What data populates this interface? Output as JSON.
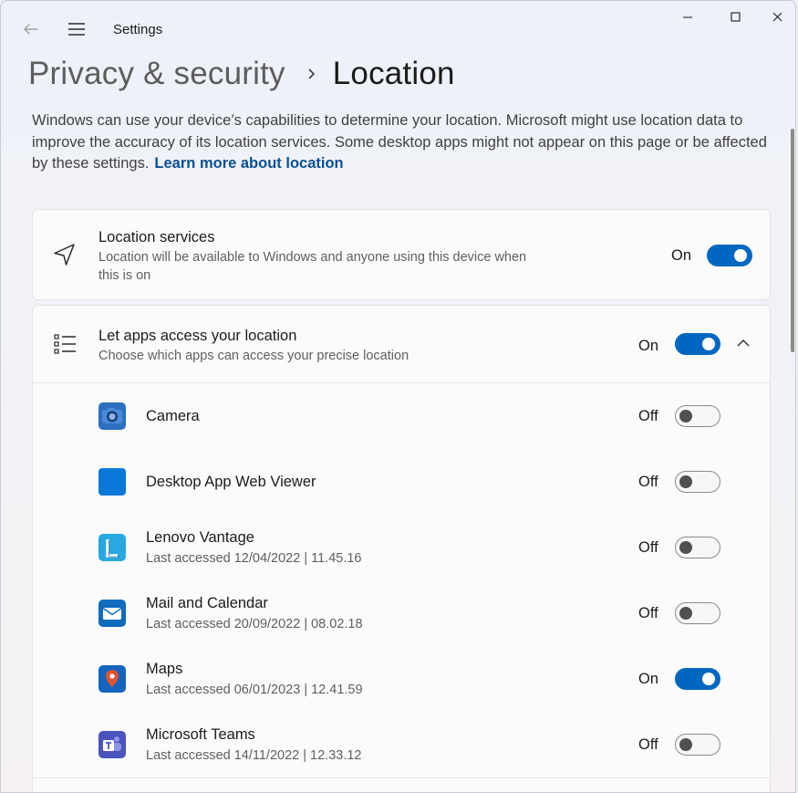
{
  "window": {
    "app_title": "Settings",
    "back_icon": "back-arrow-icon",
    "menu_icon": "hamburger-menu-icon",
    "controls": [
      "minimize-icon",
      "maximize-icon",
      "close-icon"
    ]
  },
  "breadcrumb": {
    "parent": "Privacy & security",
    "separator_icon": "chevron-right-icon",
    "current": "Location"
  },
  "description": {
    "text": "Windows can use your device’s capabilities to determine your location. Microsoft might use location data to improve the accuracy of its location services. Some desktop apps might not appear on this page or be affected by these settings.",
    "link": "Learn more about location"
  },
  "location_services": {
    "icon": "navigation-arrow-icon",
    "title": "Location services",
    "subtitle_line1": "Location will be available to Windows and anyone using this device when",
    "subtitle_line2": "this is on",
    "state": "On",
    "enabled": true
  },
  "apps_access": {
    "icon": "list-icon",
    "title": "Let apps access your location",
    "subtitle": "Choose which apps can access your precise location",
    "state": "On",
    "enabled": true,
    "expand_icon": "chevron-up-icon"
  },
  "apps": [
    {
      "name": "Camera",
      "last_accessed": "",
      "state": "Off",
      "enabled": false,
      "icon": "camera-app-icon",
      "color": "#2f6fbf"
    },
    {
      "name": "Desktop App Web Viewer",
      "last_accessed": "",
      "state": "Off",
      "enabled": false,
      "icon": "web-viewer-app-icon",
      "color": "#0a78d8"
    },
    {
      "name": "Lenovo Vantage",
      "last_accessed": "Last accessed 12/04/2022  |  11.45.16",
      "state": "Off",
      "enabled": false,
      "icon": "lenovo-vantage-app-icon",
      "color": "#29a8e0"
    },
    {
      "name": "Mail and Calendar",
      "last_accessed": "Last accessed 20/09/2022  |  08.02.18",
      "state": "Off",
      "enabled": false,
      "icon": "mail-app-icon",
      "color": "#0f6cbd"
    },
    {
      "name": "Maps",
      "last_accessed": "Last accessed 06/01/2023  |  12.41.59",
      "state": "On",
      "enabled": true,
      "icon": "maps-app-icon",
      "color": "#1565c0"
    },
    {
      "name": "Microsoft Teams",
      "last_accessed": "Last accessed 14/11/2022  |  12.33.12",
      "state": "Off",
      "enabled": false,
      "icon": "teams-app-icon",
      "color": "#4b53bc"
    }
  ],
  "colors": {
    "accent": "#0067c0",
    "link": "#0a4f93"
  }
}
